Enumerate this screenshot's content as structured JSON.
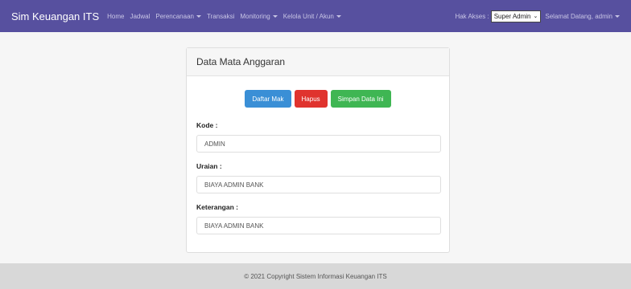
{
  "navbar": {
    "brand": "Sim Keuangan ITS",
    "links": [
      {
        "label": "Home"
      },
      {
        "label": "Jadwal"
      },
      {
        "label": "Perencanaan"
      },
      {
        "label": "Transaksi"
      },
      {
        "label": "Monitoring"
      },
      {
        "label": "Kelola Unit / Akun"
      }
    ],
    "hak_akses_label": "Hak Akses :",
    "role_value": "Super Admin",
    "greeting": "Selamat Datang, admin"
  },
  "card": {
    "title": "Data Mata Anggaran",
    "buttons": {
      "daftar": "Daftar Mak",
      "hapus": "Hapus",
      "simpan": "Simpan Data Ini"
    },
    "fields": {
      "kode": {
        "label": "Kode :",
        "value": "ADMIN"
      },
      "uraian": {
        "label": "Uraian :",
        "value": "BIAYA ADMIN BANK"
      },
      "keterangan": {
        "label": "Keterangan :",
        "value": "BIAYA ADMIN BANK"
      }
    }
  },
  "footer": {
    "text": "© 2021 Copyright Sistem Informasi Keuangan ITS"
  },
  "colors": {
    "navbar": "#57509f",
    "primary": "#3a8fd6",
    "danger": "#e0332e",
    "success": "#3fb653"
  }
}
